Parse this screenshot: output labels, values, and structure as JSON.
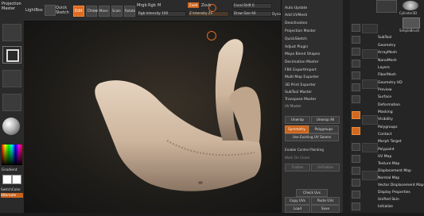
{
  "left_shelf": {
    "title": "Projection Master",
    "gradient_label": "Gradient",
    "switch_color_label": "SwitchColor",
    "alternate_label": "Alternate"
  },
  "top_bar": {
    "lightbox_label": "LightBox",
    "quick_sketch_label": "Quick Sketch",
    "edit_label": "Edit",
    "draw_label": "Draw",
    "move_label": "Move",
    "scale_label": "Scale",
    "rotate_label": "Rotate",
    "mrgb_label": "Mrgb",
    "rgb_label": "Rgb",
    "m_label": "M",
    "rgb_intensity_label": "Rgb Intensity 100",
    "zadd_label": "Zadd",
    "zsub_label": "Zsub",
    "z_intensity_label": "Z Intensity 25",
    "focal_shift_label": "Focal Shift 0",
    "draw_size_label": "Draw Size 64",
    "dynamic_label": "Dynamic"
  },
  "popup_menu": {
    "items": [
      "Auto Update",
      "Add UVMesh",
      "Deactivation",
      "Projection Master",
      "QuickSketch",
      "Adjust Plugin",
      "Maya Blend Shapes",
      "Decimation Master",
      "FBX ExportImport",
      "Multi Map Exporter",
      "3D Print Exporter",
      "SubTool Master",
      "Transpose Master",
      "UV Master"
    ],
    "unwrap_label": "Unwrap",
    "unwrap_all_label": "Unwrap All",
    "symmetry_label": "Symmetry",
    "polygroups_label": "Polygroups",
    "use_existing_uv_label": "Use Existing UV Seams",
    "enable_control_painting_label": "Enable Control Painting",
    "work_on_clone_label": "Work On Clone",
    "flatten_label": "Flatten",
    "unflatten_label": "UnFlatten",
    "check_uvs_label": "Check Uvs",
    "copy_uvs_label": "Copy UVs",
    "paste_uvs_label": "Paste UVs",
    "load_label": "Load",
    "save_label": "Save"
  },
  "right_palette": {
    "items": [
      "SubTool",
      "Geometry",
      "ArrayMesh",
      "NanoMesh",
      "Layers",
      "FiberMesh",
      "Geometry HD",
      "Preview",
      "Surface",
      "Deformation",
      "Masking",
      "Visibility",
      "Polygroups",
      "Contact",
      "Morph Target",
      "Polypaint",
      "UV Map",
      "Texture Map",
      "Displacement Map",
      "Normal Map",
      "Vector Displacement Map",
      "Display Properties",
      "Unified Skin",
      "Initialize"
    ],
    "top_tools": [
      "Cylinder3D",
      "SimpleBrush"
    ]
  },
  "colors": {
    "accent": "#e06a1e",
    "bone": "#d8c3ad"
  }
}
